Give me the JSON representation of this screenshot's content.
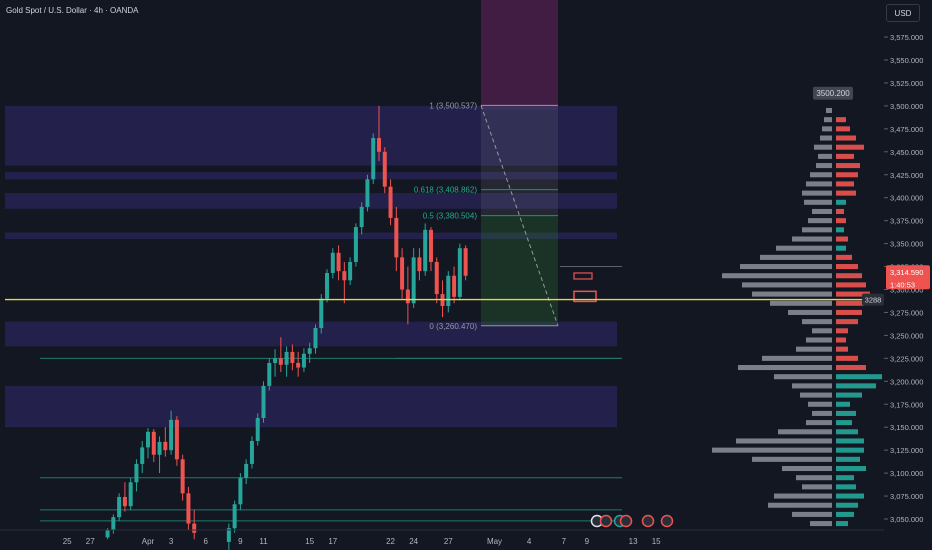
{
  "header": {
    "symbol_title": "Gold Spot / U.S. Dollar · 4h · OANDA",
    "currency_button": "USD"
  },
  "colors": {
    "background": "#131722",
    "up": "#26a69a",
    "down": "#ef5350",
    "horizontal_line": "#e8d83a",
    "zone": "#2a2659",
    "time_highlight": "#4a1f49",
    "fib_line": "#089981",
    "profile_neutral": "#9ea3ad"
  },
  "chart_data": {
    "type": "candlestick",
    "y_ticks": [
      "3,575.000",
      "3,550.000",
      "3,525.000",
      "3,500.000",
      "3,475.000",
      "3,450.000",
      "3,425.000",
      "3,400.000",
      "3,375.000",
      "3,350.000",
      "3,325.000",
      "3,300.000",
      "3,275.000",
      "3,250.000",
      "3,225.000",
      "3,200.000",
      "3,175.000",
      "3,150.000",
      "3,125.000",
      "3,100.000",
      "3,075.000",
      "3,050.000"
    ],
    "y_tick_values": [
      3575,
      3550,
      3525,
      3500,
      3475,
      3450,
      3425,
      3400,
      3375,
      3350,
      3325,
      3300,
      3275,
      3250,
      3225,
      3200,
      3175,
      3150,
      3125,
      3100,
      3075,
      3050
    ],
    "x_ticks": [
      {
        "label": "25",
        "day": -7
      },
      {
        "label": "27",
        "day": -5
      },
      {
        "label": "Apr",
        "day": 0
      },
      {
        "label": "3",
        "day": 2
      },
      {
        "label": "6",
        "day": 5
      },
      {
        "label": "9",
        "day": 8
      },
      {
        "label": "11",
        "day": 10
      },
      {
        "label": "15",
        "day": 14
      },
      {
        "label": "17",
        "day": 16
      },
      {
        "label": "22",
        "day": 21
      },
      {
        "label": "24",
        "day": 23
      },
      {
        "label": "27",
        "day": 26
      },
      {
        "label": "May",
        "day": 30
      },
      {
        "label": "4",
        "day": 33
      },
      {
        "label": "7",
        "day": 36
      },
      {
        "label": "9",
        "day": 38
      },
      {
        "label": "13",
        "day": 42
      },
      {
        "label": "15",
        "day": 44
      }
    ],
    "ylim": [
      3038,
      3598
    ],
    "candles": [
      {
        "day": -3.5,
        "o": 3030,
        "h": 3040,
        "l": 3028,
        "c": 3038
      },
      {
        "day": -3.0,
        "o": 3038,
        "h": 3055,
        "l": 3034,
        "c": 3052
      },
      {
        "day": -2.5,
        "o": 3052,
        "h": 3078,
        "l": 3048,
        "c": 3074
      },
      {
        "day": -2.0,
        "o": 3074,
        "h": 3090,
        "l": 3058,
        "c": 3064
      },
      {
        "day": -1.5,
        "o": 3064,
        "h": 3095,
        "l": 3060,
        "c": 3090
      },
      {
        "day": -1.0,
        "o": 3090,
        "h": 3115,
        "l": 3080,
        "c": 3110
      },
      {
        "day": -0.5,
        "o": 3110,
        "h": 3135,
        "l": 3100,
        "c": 3128
      },
      {
        "day": 0.0,
        "o": 3128,
        "h": 3149,
        "l": 3116,
        "c": 3145
      },
      {
        "day": 0.5,
        "o": 3145,
        "h": 3148,
        "l": 3112,
        "c": 3120
      },
      {
        "day": 1.0,
        "o": 3120,
        "h": 3140,
        "l": 3100,
        "c": 3134
      },
      {
        "day": 1.5,
        "o": 3134,
        "h": 3150,
        "l": 3118,
        "c": 3125
      },
      {
        "day": 2.0,
        "o": 3125,
        "h": 3168,
        "l": 3120,
        "c": 3158
      },
      {
        "day": 2.5,
        "o": 3158,
        "h": 3162,
        "l": 3108,
        "c": 3115
      },
      {
        "day": 3.0,
        "o": 3115,
        "h": 3120,
        "l": 3070,
        "c": 3078
      },
      {
        "day": 3.5,
        "o": 3078,
        "h": 3085,
        "l": 3038,
        "c": 3045
      },
      {
        "day": 4.0,
        "o": 3045,
        "h": 3060,
        "l": 3028,
        "c": 3035
      },
      {
        "day": 7.0,
        "o": 3025,
        "h": 3045,
        "l": 3015,
        "c": 3040
      },
      {
        "day": 7.5,
        "o": 3040,
        "h": 3070,
        "l": 3035,
        "c": 3066
      },
      {
        "day": 8.0,
        "o": 3066,
        "h": 3100,
        "l": 3060,
        "c": 3095
      },
      {
        "day": 8.5,
        "o": 3095,
        "h": 3115,
        "l": 3088,
        "c": 3110
      },
      {
        "day": 9.0,
        "o": 3110,
        "h": 3140,
        "l": 3105,
        "c": 3135
      },
      {
        "day": 9.5,
        "o": 3135,
        "h": 3165,
        "l": 3130,
        "c": 3160
      },
      {
        "day": 10.0,
        "o": 3160,
        "h": 3200,
        "l": 3155,
        "c": 3195
      },
      {
        "day": 10.5,
        "o": 3195,
        "h": 3225,
        "l": 3190,
        "c": 3220
      },
      {
        "day": 11.0,
        "o": 3220,
        "h": 3235,
        "l": 3205,
        "c": 3225
      },
      {
        "day": 11.5,
        "o": 3225,
        "h": 3248,
        "l": 3210,
        "c": 3218
      },
      {
        "day": 12.0,
        "o": 3218,
        "h": 3238,
        "l": 3205,
        "c": 3232
      },
      {
        "day": 12.5,
        "o": 3232,
        "h": 3240,
        "l": 3212,
        "c": 3220
      },
      {
        "day": 13.0,
        "o": 3220,
        "h": 3232,
        "l": 3205,
        "c": 3215
      },
      {
        "day": 13.5,
        "o": 3215,
        "h": 3236,
        "l": 3210,
        "c": 3230
      },
      {
        "day": 14.0,
        "o": 3230,
        "h": 3242,
        "l": 3220,
        "c": 3236
      },
      {
        "day": 14.5,
        "o": 3236,
        "h": 3262,
        "l": 3230,
        "c": 3258
      },
      {
        "day": 15.0,
        "o": 3258,
        "h": 3295,
        "l": 3252,
        "c": 3290
      },
      {
        "day": 15.5,
        "o": 3290,
        "h": 3322,
        "l": 3286,
        "c": 3318
      },
      {
        "day": 16.0,
        "o": 3318,
        "h": 3345,
        "l": 3312,
        "c": 3340
      },
      {
        "day": 16.5,
        "o": 3340,
        "h": 3348,
        "l": 3310,
        "c": 3320
      },
      {
        "day": 17.0,
        "o": 3320,
        "h": 3330,
        "l": 3285,
        "c": 3310
      },
      {
        "day": 17.5,
        "o": 3310,
        "h": 3335,
        "l": 3305,
        "c": 3330
      },
      {
        "day": 18.0,
        "o": 3330,
        "h": 3372,
        "l": 3325,
        "c": 3368
      },
      {
        "day": 18.5,
        "o": 3368,
        "h": 3395,
        "l": 3360,
        "c": 3390
      },
      {
        "day": 19.0,
        "o": 3390,
        "h": 3425,
        "l": 3385,
        "c": 3420
      },
      {
        "day": 19.5,
        "o": 3420,
        "h": 3470,
        "l": 3415,
        "c": 3465
      },
      {
        "day": 20.0,
        "o": 3465,
        "h": 3500,
        "l": 3440,
        "c": 3450
      },
      {
        "day": 20.5,
        "o": 3450,
        "h": 3455,
        "l": 3405,
        "c": 3412
      },
      {
        "day": 21.0,
        "o": 3412,
        "h": 3420,
        "l": 3370,
        "c": 3378
      },
      {
        "day": 21.5,
        "o": 3378,
        "h": 3390,
        "l": 3320,
        "c": 3335
      },
      {
        "day": 22.0,
        "o": 3335,
        "h": 3345,
        "l": 3290,
        "c": 3300
      },
      {
        "day": 22.5,
        "o": 3300,
        "h": 3325,
        "l": 3262,
        "c": 3285
      },
      {
        "day": 23.0,
        "o": 3285,
        "h": 3345,
        "l": 3280,
        "c": 3335
      },
      {
        "day": 23.5,
        "o": 3335,
        "h": 3345,
        "l": 3310,
        "c": 3320
      },
      {
        "day": 24.0,
        "o": 3320,
        "h": 3372,
        "l": 3315,
        "c": 3365
      },
      {
        "day": 24.5,
        "o": 3365,
        "h": 3368,
        "l": 3320,
        "c": 3330
      },
      {
        "day": 25.0,
        "o": 3330,
        "h": 3335,
        "l": 3285,
        "c": 3295
      },
      {
        "day": 25.5,
        "o": 3295,
        "h": 3310,
        "l": 3270,
        "c": 3282
      },
      {
        "day": 26.0,
        "o": 3282,
        "h": 3320,
        "l": 3275,
        "c": 3315
      },
      {
        "day": 26.5,
        "o": 3315,
        "h": 3325,
        "l": 3285,
        "c": 3292
      },
      {
        "day": 27.0,
        "o": 3292,
        "h": 3350,
        "l": 3288,
        "c": 3345
      },
      {
        "day": 27.5,
        "o": 3345,
        "h": 3348,
        "l": 3310,
        "c": 3315
      }
    ],
    "fib_levels": [
      {
        "label": "1 (3,500.537)",
        "value": 3500.537
      },
      {
        "label": "0.618 (3,408.862)",
        "value": 3408.862
      },
      {
        "label": "0.5 (3,380.504)",
        "value": 3380.504
      },
      {
        "label": "0 (3,260.470)",
        "value": 3260.47
      }
    ],
    "zones": [
      {
        "from": 3435,
        "to": 3500
      },
      {
        "from": 3420,
        "to": 3428
      },
      {
        "from": 3388,
        "to": 3405
      },
      {
        "from": 3355,
        "to": 3362
      },
      {
        "from": 3238,
        "to": 3265
      },
      {
        "from": 3150,
        "to": 3195
      }
    ],
    "support_lines": [
      3325,
      3225,
      3095,
      3060,
      3048
    ],
    "horizontal_line": 3289,
    "volume_profile_left": [
      {
        "p": 3495,
        "w": 6
      },
      {
        "p": 3485,
        "w": 8
      },
      {
        "p": 3475,
        "w": 10
      },
      {
        "p": 3465,
        "w": 12
      },
      {
        "p": 3455,
        "w": 18
      },
      {
        "p": 3445,
        "w": 14
      },
      {
        "p": 3435,
        "w": 16
      },
      {
        "p": 3425,
        "w": 22
      },
      {
        "p": 3415,
        "w": 26
      },
      {
        "p": 3405,
        "w": 30
      },
      {
        "p": 3395,
        "w": 28
      },
      {
        "p": 3385,
        "w": 20
      },
      {
        "p": 3375,
        "w": 24
      },
      {
        "p": 3365,
        "w": 30
      },
      {
        "p": 3355,
        "w": 40
      },
      {
        "p": 3345,
        "w": 56
      },
      {
        "p": 3335,
        "w": 72
      },
      {
        "p": 3325,
        "w": 92
      },
      {
        "p": 3315,
        "w": 110
      },
      {
        "p": 3305,
        "w": 90
      },
      {
        "p": 3295,
        "w": 80
      },
      {
        "p": 3285,
        "w": 62
      },
      {
        "p": 3275,
        "w": 44
      },
      {
        "p": 3265,
        "w": 30
      },
      {
        "p": 3255,
        "w": 20
      },
      {
        "p": 3245,
        "w": 26
      },
      {
        "p": 3235,
        "w": 36
      },
      {
        "p": 3225,
        "w": 70
      },
      {
        "p": 3215,
        "w": 94
      },
      {
        "p": 3205,
        "w": 58
      },
      {
        "p": 3195,
        "w": 40
      },
      {
        "p": 3185,
        "w": 32
      },
      {
        "p": 3175,
        "w": 24
      },
      {
        "p": 3165,
        "w": 20
      },
      {
        "p": 3155,
        "w": 26
      },
      {
        "p": 3145,
        "w": 54
      },
      {
        "p": 3135,
        "w": 96
      },
      {
        "p": 3125,
        "w": 120
      },
      {
        "p": 3115,
        "w": 80
      },
      {
        "p": 3105,
        "w": 50
      },
      {
        "p": 3095,
        "w": 36
      },
      {
        "p": 3085,
        "w": 30
      },
      {
        "p": 3075,
        "w": 58
      },
      {
        "p": 3065,
        "w": 64
      },
      {
        "p": 3055,
        "w": 40
      },
      {
        "p": 3045,
        "w": 22
      }
    ],
    "volume_profile_right": [
      {
        "p": 3485,
        "w": 10,
        "c": "down"
      },
      {
        "p": 3475,
        "w": 14,
        "c": "down"
      },
      {
        "p": 3465,
        "w": 20,
        "c": "down"
      },
      {
        "p": 3455,
        "w": 28,
        "c": "down"
      },
      {
        "p": 3445,
        "w": 18,
        "c": "down"
      },
      {
        "p": 3435,
        "w": 24,
        "c": "down"
      },
      {
        "p": 3425,
        "w": 22,
        "c": "down"
      },
      {
        "p": 3415,
        "w": 18,
        "c": "down"
      },
      {
        "p": 3405,
        "w": 20,
        "c": "down"
      },
      {
        "p": 3395,
        "w": 10,
        "c": "up"
      },
      {
        "p": 3385,
        "w": 8,
        "c": "down"
      },
      {
        "p": 3375,
        "w": 10,
        "c": "down"
      },
      {
        "p": 3365,
        "w": 8,
        "c": "up"
      },
      {
        "p": 3355,
        "w": 12,
        "c": "down"
      },
      {
        "p": 3345,
        "w": 10,
        "c": "up"
      },
      {
        "p": 3335,
        "w": 16,
        "c": "down"
      },
      {
        "p": 3325,
        "w": 22,
        "c": "down"
      },
      {
        "p": 3315,
        "w": 26,
        "c": "down"
      },
      {
        "p": 3305,
        "w": 30,
        "c": "down"
      },
      {
        "p": 3295,
        "w": 34,
        "c": "down"
      },
      {
        "p": 3285,
        "w": 28,
        "c": "down"
      },
      {
        "p": 3275,
        "w": 26,
        "c": "down"
      },
      {
        "p": 3265,
        "w": 22,
        "c": "down"
      },
      {
        "p": 3255,
        "w": 12,
        "c": "down"
      },
      {
        "p": 3245,
        "w": 10,
        "c": "down"
      },
      {
        "p": 3235,
        "w": 12,
        "c": "down"
      },
      {
        "p": 3225,
        "w": 22,
        "c": "down"
      },
      {
        "p": 3215,
        "w": 30,
        "c": "down"
      },
      {
        "p": 3205,
        "w": 46,
        "c": "up"
      },
      {
        "p": 3195,
        "w": 40,
        "c": "up"
      },
      {
        "p": 3185,
        "w": 26,
        "c": "up"
      },
      {
        "p": 3175,
        "w": 14,
        "c": "up"
      },
      {
        "p": 3165,
        "w": 20,
        "c": "up"
      },
      {
        "p": 3155,
        "w": 16,
        "c": "up"
      },
      {
        "p": 3145,
        "w": 22,
        "c": "up"
      },
      {
        "p": 3135,
        "w": 28,
        "c": "up"
      },
      {
        "p": 3125,
        "w": 28,
        "c": "up"
      },
      {
        "p": 3115,
        "w": 24,
        "c": "up"
      },
      {
        "p": 3105,
        "w": 30,
        "c": "up"
      },
      {
        "p": 3095,
        "w": 18,
        "c": "up"
      },
      {
        "p": 3085,
        "w": 20,
        "c": "up"
      },
      {
        "p": 3075,
        "w": 28,
        "c": "up"
      },
      {
        "p": 3065,
        "w": 22,
        "c": "up"
      },
      {
        "p": 3055,
        "w": 18,
        "c": "up"
      },
      {
        "p": 3045,
        "w": 12,
        "c": "up"
      }
    ],
    "price_badges": [
      {
        "label": "3500.200",
        "value": 3500.2,
        "style": "neutral"
      },
      {
        "label": "3,314.590",
        "value": 3321,
        "style": "down"
      },
      {
        "label": "1:40:53",
        "value": 3310,
        "style": "down"
      },
      {
        "label": "3288",
        "value": 3289,
        "style": "neutral"
      }
    ]
  }
}
